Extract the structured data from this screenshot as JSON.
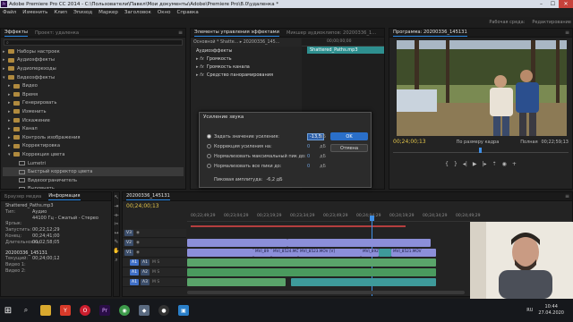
{
  "titlebar": {
    "app_icon": "Pr",
    "title": "Adobe Premiere Pro CC 2014 - C:\\Пользователи\\Павел\\Мои документы\\Adobe\\Premiere Pro\\8.0\\удаленка *",
    "minimize": "–",
    "maximize": "☐",
    "close": "✕"
  },
  "menu": [
    "Файл",
    "Изменить",
    "Клип",
    "Эпизод",
    "Маркер",
    "Заголовок",
    "Окно",
    "Справка"
  ],
  "workspaces": [
    "Рабочая среда:",
    "Редактирование"
  ],
  "effects_panel": {
    "tabs": [
      "Эффекты",
      "Проект: удаленка"
    ],
    "tree": [
      {
        "label": "Наборы настроек",
        "indent": 1,
        "icon": "folder"
      },
      {
        "label": "Аудиоэффекты",
        "indent": 1,
        "icon": "folder"
      },
      {
        "label": "Аудиопереходы",
        "indent": 1,
        "icon": "folder"
      },
      {
        "label": "Видеоэффекты",
        "indent": 1,
        "icon": "folder",
        "open": true
      },
      {
        "label": "Видео",
        "indent": 2,
        "icon": "folder"
      },
      {
        "label": "Время",
        "indent": 2,
        "icon": "folder"
      },
      {
        "label": "Генерировать",
        "indent": 2,
        "icon": "folder"
      },
      {
        "label": "Изменить",
        "indent": 2,
        "icon": "folder"
      },
      {
        "label": "Искажение",
        "indent": 2,
        "icon": "folder"
      },
      {
        "label": "Канал",
        "indent": 2,
        "icon": "folder"
      },
      {
        "label": "Контроль изображения",
        "indent": 2,
        "icon": "folder"
      },
      {
        "label": "Корректировка",
        "indent": 2,
        "icon": "folder"
      },
      {
        "label": "Коррекция цвета",
        "indent": 2,
        "icon": "folder",
        "open": true
      },
      {
        "label": "Lumetri",
        "indent": 3,
        "icon": "fx"
      },
      {
        "label": "Быстрый корректор цвета",
        "indent": 3,
        "icon": "fx",
        "selected": true
      },
      {
        "label": "Видеоограничитель",
        "indent": 3,
        "icon": "fx"
      },
      {
        "label": "Выровнять",
        "indent": 3,
        "icon": "fx"
      }
    ]
  },
  "effect_controls": {
    "tabs": [
      "Элементы управления эффектами",
      "Микшер аудиоклипов: 20200336_1..."
    ],
    "header": "Основной * Shatte... ▸ 20200336_145...",
    "section": "Аудиоэффекты",
    "rows": [
      "Громкость",
      "Громкость канала",
      "Средство панорамирования"
    ],
    "clip_name": "Shattered_Paths.mp3",
    "ruler_time": "00;00;00;00"
  },
  "program": {
    "tab": "Программа: 20200336_145131",
    "timecode": "00;24;00;13",
    "fit": "По размеру кадра",
    "quality": "Полная",
    "duration": "00;22;59;13"
  },
  "info_panel": {
    "tabs": [
      "Браузер медиа",
      "Информация"
    ],
    "clip_title": "Shattered_Paths.mp3",
    "lines": [
      {
        "label": "Тип:",
        "value": "Аудио"
      },
      {
        "label": "",
        "value": "44100 Гц - Сжатый - Стерео"
      },
      {
        "label": "Ярлык:",
        "value": ""
      },
      {
        "label": "Запустить:",
        "value": "00;22;12;29"
      },
      {
        "label": "Конец:",
        "value": "00;24;41;00"
      },
      {
        "label": "Длительность:",
        "value": "00;02;58;05"
      }
    ],
    "seq_title": "20200336_145131",
    "seq_lines": [
      {
        "label": "Текущий:",
        "value": "00;24;00;12"
      },
      {
        "label": "Видео 1:",
        "value": ""
      },
      {
        "label": "Видео 2:",
        "value": ""
      }
    ]
  },
  "timeline": {
    "tab": "20200336_145131",
    "timecode": "00;24;00;13",
    "ticks": [
      "00;22;49;29",
      "00;23;04;29",
      "00;23;19;29",
      "00;23;34;29",
      "00;23;49;29",
      "00;24;04;29",
      "00;24;19;29",
      "00;24;34;29",
      "00;24;49;29"
    ],
    "tracks": [
      {
        "name": "V3",
        "kind": "video"
      },
      {
        "name": "V2",
        "kind": "video"
      },
      {
        "name": "V1",
        "kind": "video"
      },
      {
        "name": "A1",
        "kind": "audio"
      },
      {
        "name": "A2",
        "kind": "audio"
      },
      {
        "name": "A3",
        "kind": "audio"
      }
    ],
    "clips": [
      "MVI_89",
      "MVI_8524.MOV",
      "MVI_8523.MOV [V]",
      "MVI_892",
      "MVI_8521.MOV"
    ]
  },
  "gain_dialog": {
    "title": "Усиление звука",
    "rows": [
      {
        "label": "Задать значение усиления:",
        "value": "-13,5",
        "unit": "дБ",
        "checked": true
      },
      {
        "label": "Коррекция усиления на:",
        "value": "0",
        "unit": "дБ",
        "checked": false
      },
      {
        "label": "Нормализовать максимальный пик до:",
        "value": "0",
        "unit": "дБ",
        "checked": false
      },
      {
        "label": "Нормализовать все пики до:",
        "value": "0",
        "unit": "дБ",
        "checked": false
      }
    ],
    "peak_label": "Пиковая амплитуда:",
    "peak_value": "-6,2 дБ",
    "ok": "OK",
    "cancel": "Отмена"
  },
  "taskbar": {
    "tray_lang": "RU",
    "time": "10:44",
    "date": "27.04.2020"
  },
  "colors": {
    "accent": "#2d8ceb",
    "timecode": "#e0c34a",
    "video_clip": "#8c8fd9",
    "audio_clip": "#5aa46a"
  }
}
